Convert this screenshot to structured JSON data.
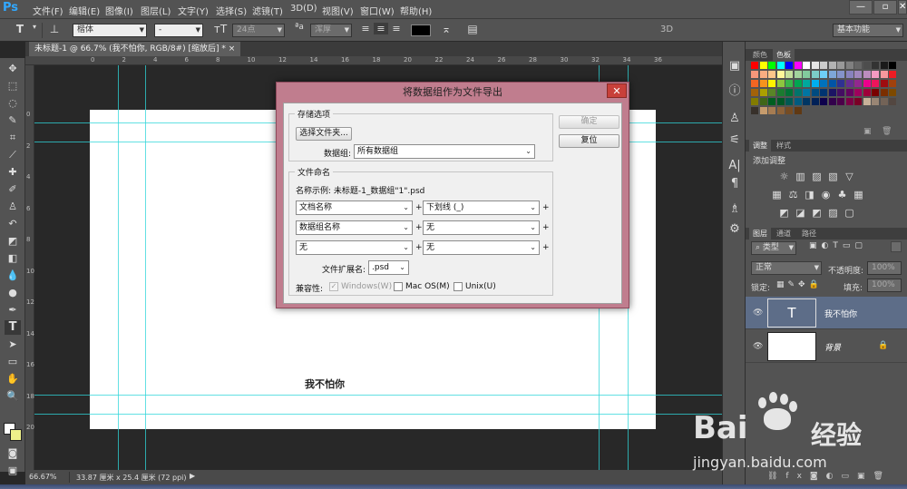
{
  "app": {
    "logo": "Ps",
    "menu": [
      "文件(F)",
      "编辑(E)",
      "图像(I)",
      "图层(L)",
      "文字(Y)",
      "选择(S)",
      "滤镜(T)",
      "3D(D)",
      "视图(V)",
      "窗口(W)",
      "帮助(H)"
    ],
    "window_controls": [
      "—",
      "▫",
      "✕"
    ]
  },
  "options_bar": {
    "font_family": "楷体",
    "font_style": "-",
    "font_size": "24点",
    "aa_label": "ªa",
    "aa_mode": "浑厚",
    "mode_3d": "3D",
    "workspace": "基本功能"
  },
  "document": {
    "tab_title": "未标题-1 @ 66.7% (我不怕你, RGB/8#) [缩放后] *",
    "tab_close": "×",
    "canvas_text": "我不怕你",
    "ruler_h": [
      "0",
      "2",
      "4",
      "6",
      "8",
      "10",
      "12",
      "14",
      "16",
      "18",
      "20",
      "22",
      "24",
      "26",
      "28",
      "30",
      "32",
      "34",
      "36"
    ],
    "ruler_v": [
      "0",
      "2",
      "4",
      "6",
      "8",
      "10",
      "12",
      "14",
      "16",
      "18",
      "20"
    ]
  },
  "status": {
    "zoom": "66.67%",
    "doc_size": "33.87 厘米 x 25.4 厘米 (72 ppi)"
  },
  "panels": {
    "swatch_tabs": [
      "颜色",
      "色板"
    ],
    "adjust_tabs": [
      "调整",
      "样式"
    ],
    "adjust_title": "添加调整",
    "layers_tabs": [
      "图层",
      "通道",
      "路径"
    ],
    "filter_kind": "类型",
    "blend_mode": "正常",
    "opacity_label": "不透明度:",
    "opacity_value": "100%",
    "lock_label": "锁定:",
    "fill_label": "填充:",
    "fill_value": "100%",
    "layers": [
      {
        "name": "我不怕你",
        "type": "text",
        "thumb": "T"
      },
      {
        "name": "背景",
        "type": "background",
        "thumb": ""
      }
    ],
    "swatch_colors": [
      "#ff0000",
      "#ffff00",
      "#00ff00",
      "#00ffff",
      "#0000ff",
      "#ff00ff",
      "#ffffff",
      "#e6e6e6",
      "#cccccc",
      "#b3b3b3",
      "#999999",
      "#808080",
      "#666666",
      "#4d4d4d",
      "#333333",
      "#1a1a1a",
      "#000000",
      "#f7977a",
      "#f9ad81",
      "#fdc68a",
      "#fff79a",
      "#c4df9b",
      "#a2d39c",
      "#82ca9d",
      "#7bcdc8",
      "#6ecff6",
      "#7ea7d8",
      "#8493ca",
      "#8882be",
      "#a187be",
      "#bc8dbf",
      "#f49ac2",
      "#f6989d",
      "#ed1c24",
      "#f26522",
      "#f7941d",
      "#fff200",
      "#8dc63f",
      "#39b54a",
      "#00a651",
      "#00a99d",
      "#00aeef",
      "#0072bc",
      "#0054a6",
      "#2e3192",
      "#662d91",
      "#92278f",
      "#ec008c",
      "#ed145b",
      "#9e0b0f",
      "#a0410d",
      "#a3620a",
      "#aba000",
      "#598527",
      "#1a7b30",
      "#007236",
      "#00746b",
      "#0076a3",
      "#004b80",
      "#003471",
      "#1b1464",
      "#440e62",
      "#630460",
      "#9e005d",
      "#9e0039",
      "#790000",
      "#7b2e00",
      "#7d4900",
      "#827b00",
      "#406618",
      "#005e20",
      "#005826",
      "#005952",
      "#005b7f",
      "#003663",
      "#002157",
      "#0d004c",
      "#32004b",
      "#4b0049",
      "#7b0046",
      "#7a0026",
      "#c7b299",
      "#998675",
      "#736357",
      "#534741",
      "#37302a",
      "#c69c6d",
      "#a67c52",
      "#8c6239",
      "#754c24",
      "#603913"
    ]
  },
  "dialog": {
    "title": "将数据组作为文件导出",
    "close": "✕",
    "storage_legend": "存储选项",
    "choose_folder": "选择文件夹...",
    "dataset_label": "数据组:",
    "dataset_value": "所有数据组",
    "ok": "确定",
    "reset": "复位",
    "naming_legend": "文件命名",
    "name_example": "名称示例: 未标题-1_数据组\"1\".psd",
    "name_rows": [
      [
        "文档名称",
        "下划线 (_)"
      ],
      [
        "数据组名称",
        "无"
      ],
      [
        "无",
        "无"
      ]
    ],
    "plus": "+",
    "ext_label": "文件扩展名:",
    "ext_value": ".psd",
    "compat_label": "兼容性:",
    "compat_windows": "Windows(W)",
    "compat_mac": "Mac OS(M)",
    "compat_unix": "Unix(U)",
    "checkmark": "✓"
  },
  "watermark": {
    "brand": "Bai",
    "brand2": "经验",
    "url": "jingyan.baidu.com"
  }
}
